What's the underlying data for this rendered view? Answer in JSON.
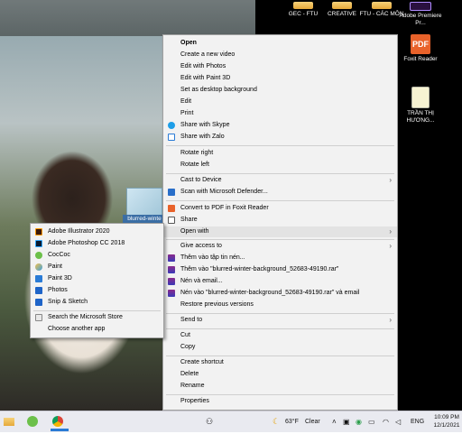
{
  "desktop": {
    "icons": [
      {
        "label": "GEC - FTU"
      },
      {
        "label": "CREATIVE"
      },
      {
        "label": "FTU - CÁC MÔN"
      },
      {
        "label": "Adobe Premiere Pr..."
      },
      {
        "label": "Foxit Reader"
      },
      {
        "label": "TRẦN THỊ HƯƠNG..."
      }
    ],
    "selected_file_label": "blurred-winte"
  },
  "context_menu": {
    "items": [
      {
        "label": "Open"
      },
      {
        "label": "Create a new video"
      },
      {
        "label": "Edit with Photos"
      },
      {
        "label": "Edit with Paint 3D"
      },
      {
        "label": "Set as desktop background"
      },
      {
        "label": "Edit"
      },
      {
        "label": "Print"
      },
      {
        "label": "Share with Skype"
      },
      {
        "label": "Share with Zalo"
      },
      {
        "label": "Rotate right"
      },
      {
        "label": "Rotate left"
      },
      {
        "label": "Cast to Device"
      },
      {
        "label": "Scan with Microsoft Defender..."
      },
      {
        "label": "Convert to PDF in Foxit Reader"
      },
      {
        "label": "Share"
      },
      {
        "label": "Open with"
      },
      {
        "label": "Give access to"
      },
      {
        "label": "Thêm vào tập tin nén..."
      },
      {
        "label": "Thêm vào \"blurred-winter-background_52683-49190.rar\""
      },
      {
        "label": "Nén và email..."
      },
      {
        "label": "Nén vào \"blurred-winter-background_52683-49190.rar\" và email"
      },
      {
        "label": "Restore previous versions"
      },
      {
        "label": "Send to"
      },
      {
        "label": "Cut"
      },
      {
        "label": "Copy"
      },
      {
        "label": "Create shortcut"
      },
      {
        "label": "Delete"
      },
      {
        "label": "Rename"
      },
      {
        "label": "Properties"
      }
    ]
  },
  "open_with_submenu": {
    "items": [
      {
        "label": "Adobe Illustrator 2020"
      },
      {
        "label": "Adobe Photoshop CC 2018"
      },
      {
        "label": "CocCoc"
      },
      {
        "label": "Paint"
      },
      {
        "label": "Paint 3D"
      },
      {
        "label": "Photos"
      },
      {
        "label": "Snip & Sketch"
      },
      {
        "label": "Search the Microsoft Store"
      },
      {
        "label": "Choose another app"
      }
    ]
  },
  "taskbar": {
    "weather_temp": "63°F",
    "weather_text": "Clear",
    "language": "ENG",
    "time": "10:09 PM",
    "date": "12/1/2021"
  },
  "colors": {
    "menu_bg": "#f2f2f2",
    "hover_bg": "#e3e3e3",
    "taskbar_bg": "#e9eaf0",
    "accent": "#2a7bd6"
  }
}
